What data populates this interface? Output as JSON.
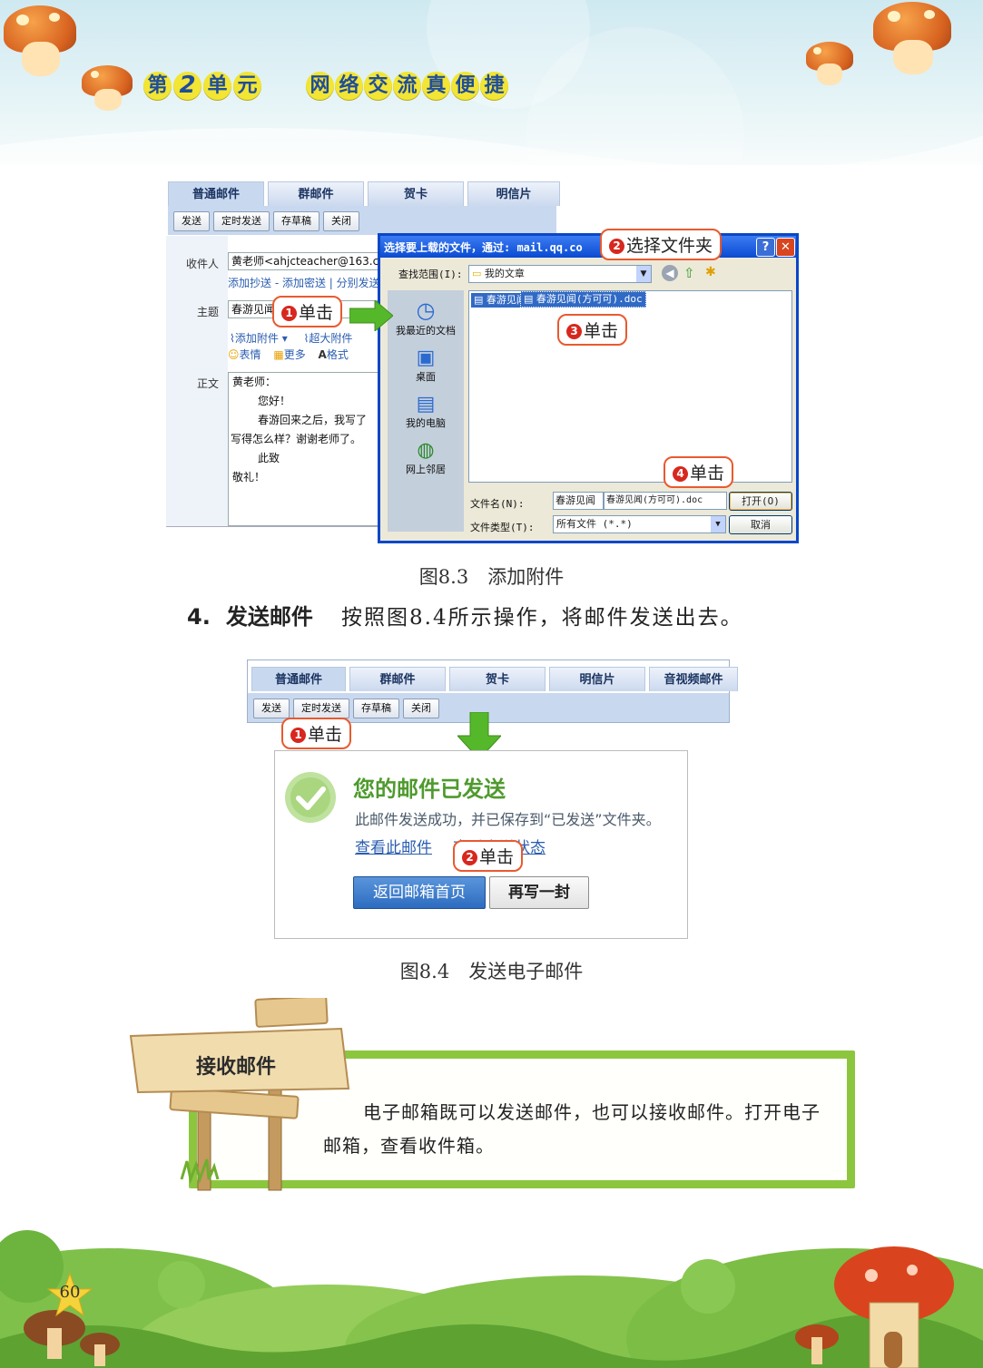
{
  "header": {
    "unit_prefix": "第",
    "unit_number": "2",
    "unit_suffix": "单",
    "unit_suffix2": "元",
    "unit_title_chars": [
      "网",
      "络",
      "交",
      "流",
      "真",
      "便",
      "捷"
    ]
  },
  "fig1": {
    "tabs": [
      "普通邮件",
      "群邮件",
      "贺卡",
      "明信片"
    ],
    "toolbar": [
      "发送",
      "定时发送",
      "存草稿",
      "关闭"
    ],
    "to_label": "收件人",
    "to_value": "黄老师<ahjcteacher@163.c",
    "cc_links": "添加抄送 - 添加密送 | 分别发送",
    "subject_label": "主题",
    "subject_value": "春游见闻",
    "attach_link": "添加附件",
    "big_attach_link": "超大附件",
    "emoji_label": "表情",
    "more_label": "更多",
    "format_label": "格式",
    "body_label": "正文",
    "body_lines": [
      "黄老师：",
      "您好！",
      "春游回来之后，我写了",
      "写得怎么样？谢谢老师了。",
      "此致",
      "敬礼！"
    ],
    "dialog": {
      "title": "选择要上载的文件，通过: mail.qq.co",
      "lookin_label": "查找范围(I):",
      "lookin_value": "我的文章",
      "places": [
        "我最近的文档",
        "桌面",
        "我的电脑",
        "网上邻居"
      ],
      "files": [
        "春游见闻",
        "春游见闻(方可可).doc"
      ],
      "filename_label": "文件名(N):",
      "filename_value1": "春游见闻",
      "filename_value2": "春游见闻(方可可).doc",
      "filetype_label": "文件类型(T):",
      "filetype_value": "所有文件 (*.*)",
      "open_button": "打开(O)",
      "cancel_button": "取消"
    },
    "callouts": [
      {
        "num": "1",
        "text": "单击"
      },
      {
        "num": "2",
        "text": "选择文件夹"
      },
      {
        "num": "3",
        "text": "单击"
      },
      {
        "num": "4",
        "text": "单击"
      }
    ],
    "caption": "图8.3　添加附件"
  },
  "section4": {
    "number": "4.",
    "heading": "发送邮件",
    "text": "按照图8.4所示操作，将邮件发送出去。"
  },
  "fig2": {
    "tabs": [
      "普通邮件",
      "群邮件",
      "贺卡",
      "明信片",
      "音视频邮件"
    ],
    "toolbar": [
      "发送",
      "定时发送",
      "存草稿",
      "关闭"
    ],
    "success_title": "您的邮件已发送",
    "success_desc": "此邮件发送成功，并已保存到“已发送”文件夹。",
    "view_link": "查看此邮件",
    "status_link": "查看发送状态",
    "return_button": "返回邮箱首页",
    "rewrite_button": "再写一封",
    "callouts": [
      {
        "num": "1",
        "text": "单击"
      },
      {
        "num": "2",
        "text": "单击"
      }
    ],
    "caption": "图8.4　发送电子邮件"
  },
  "tipbox": {
    "sign_title": "接收邮件",
    "text": "电子邮箱既可以发送邮件，也可以接收邮件。打开电子邮箱，查看收件箱。"
  },
  "footer": {
    "page_number": "60"
  },
  "colors": {
    "unit_chip": "#f2e534",
    "unit_text": "#1f4d9a",
    "callout_border": "#e85a2f",
    "callout_number": "#d8271e",
    "success_green": "#4f9a2e",
    "arrow_green": "#55b82a",
    "grass_frame": "#8cc63f"
  }
}
